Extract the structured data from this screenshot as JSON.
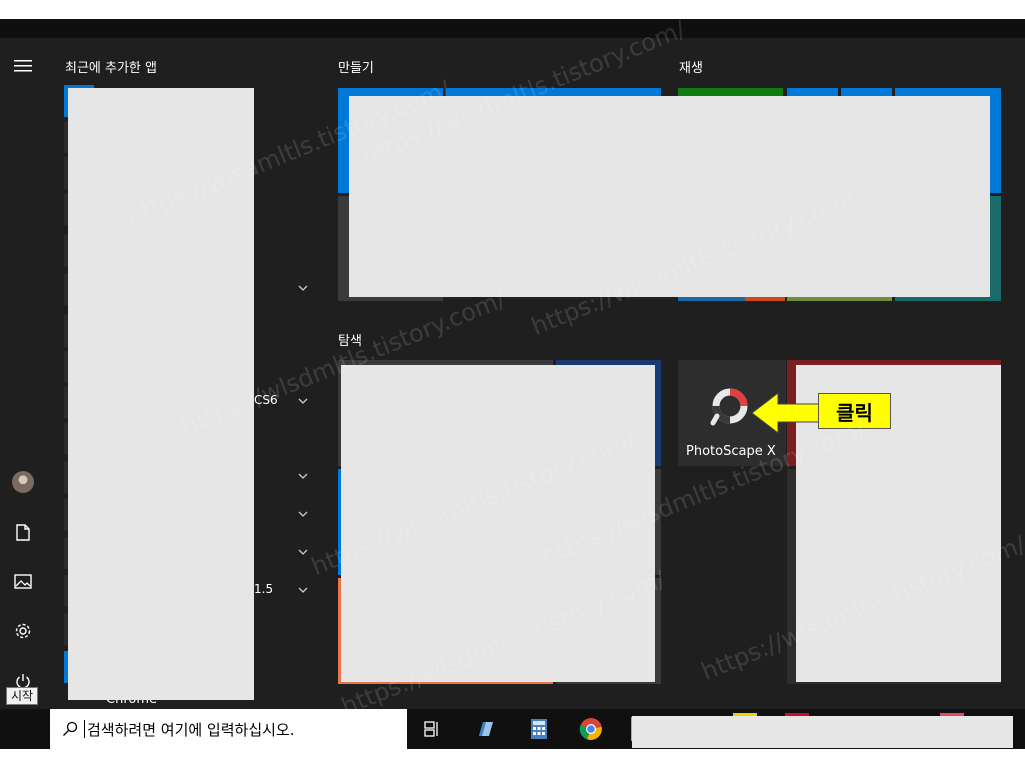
{
  "start_menu": {
    "recent_header": "최근에 추가한 앱",
    "groups": {
      "create": "만들기",
      "play": "재생",
      "explore": "탐색"
    },
    "app_list": {
      "suffix_cs6": "CS6",
      "suffix_15": "1.5",
      "chrome_label": "Chrome"
    },
    "photoscape": {
      "name": "PhotoScape X"
    },
    "callout_text": "클릭",
    "start_tooltip": "시작",
    "watermark": "https://wlsdmltls.tistory.com/"
  },
  "rail": {
    "icons": [
      "hamburger-icon",
      "user-avatar",
      "document-icon",
      "pictures-icon",
      "settings-icon",
      "power-icon"
    ]
  },
  "taskbar": {
    "search_placeholder": "검색하려면 여기에 입력하십시오.",
    "icons": [
      "task-view-icon",
      "mail-icon",
      "calculator-icon",
      "chrome-icon"
    ]
  },
  "colors": {
    "tile_blue": "#0078d7",
    "tile_green": "#107c10",
    "redaction": "#e6e6e6",
    "callout_yellow": "#ffff00"
  }
}
